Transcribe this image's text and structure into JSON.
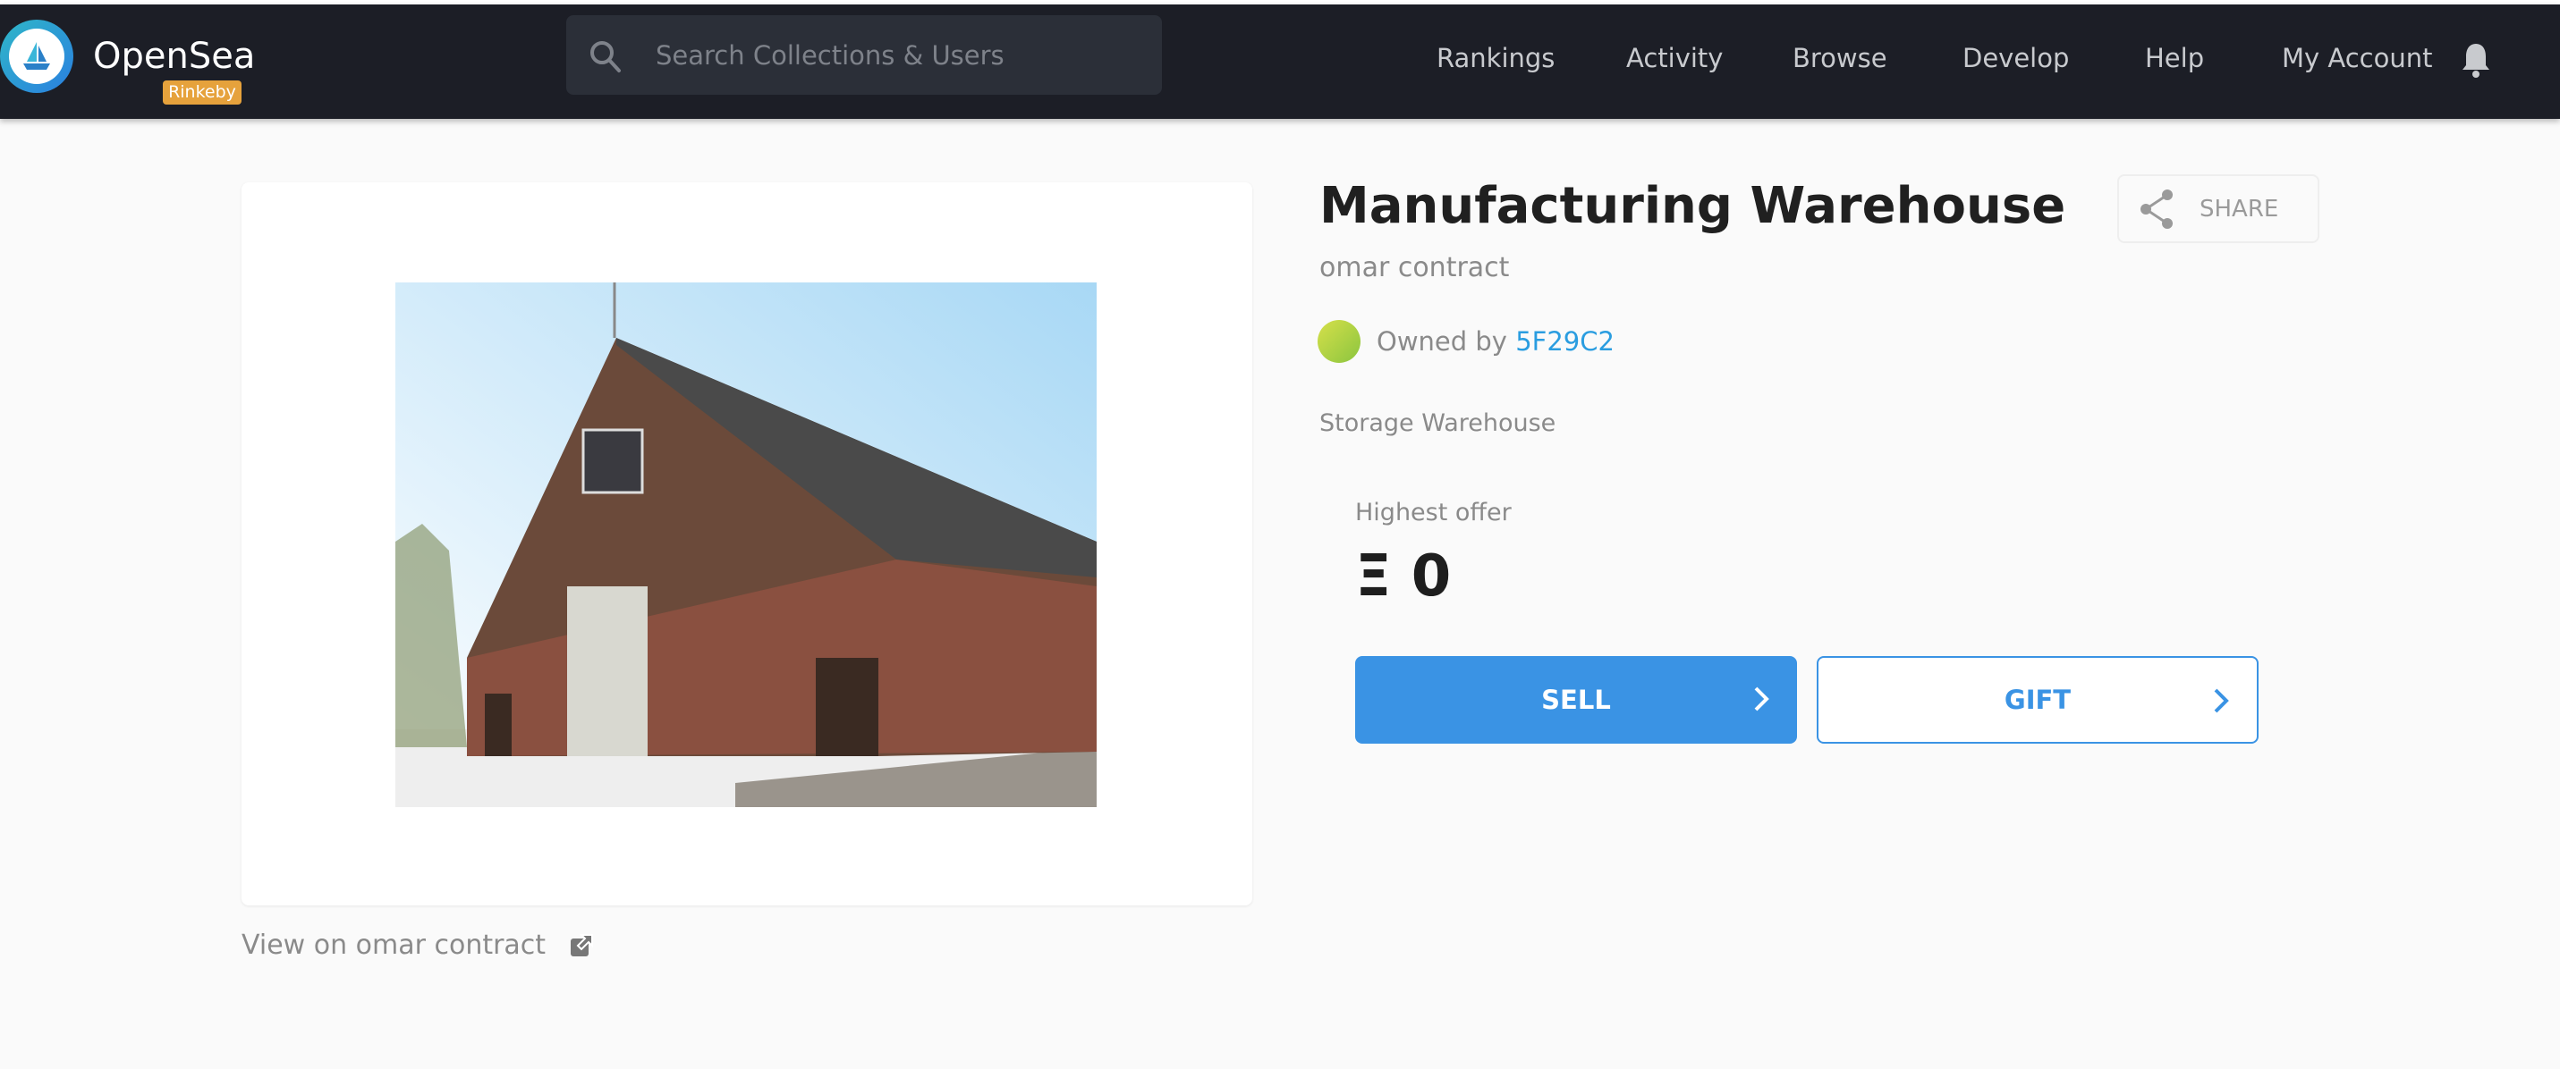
{
  "header": {
    "brand": "OpenSea",
    "network_badge": "Rinkeby",
    "search_placeholder": "Search Collections & Users",
    "nav": [
      "Rankings",
      "Activity",
      "Browse",
      "Develop",
      "Help",
      "My Account"
    ]
  },
  "asset": {
    "title": "Manufacturing Warehouse",
    "collection": "omar contract",
    "owned_by_label": "Owned by",
    "owner": "5F29C2",
    "description": "Storage Warehouse",
    "view_link": "View on omar contract",
    "share_label": "SHARE",
    "highest_offer_label": "Highest offer",
    "highest_offer_value": "Ξ 0",
    "sell_label": "SELL",
    "gift_label": "GIFT"
  },
  "colors": {
    "accent": "#3a93e4",
    "header_bg": "#1c1e26",
    "badge": "#e6a23c",
    "link": "#2a9de0"
  }
}
